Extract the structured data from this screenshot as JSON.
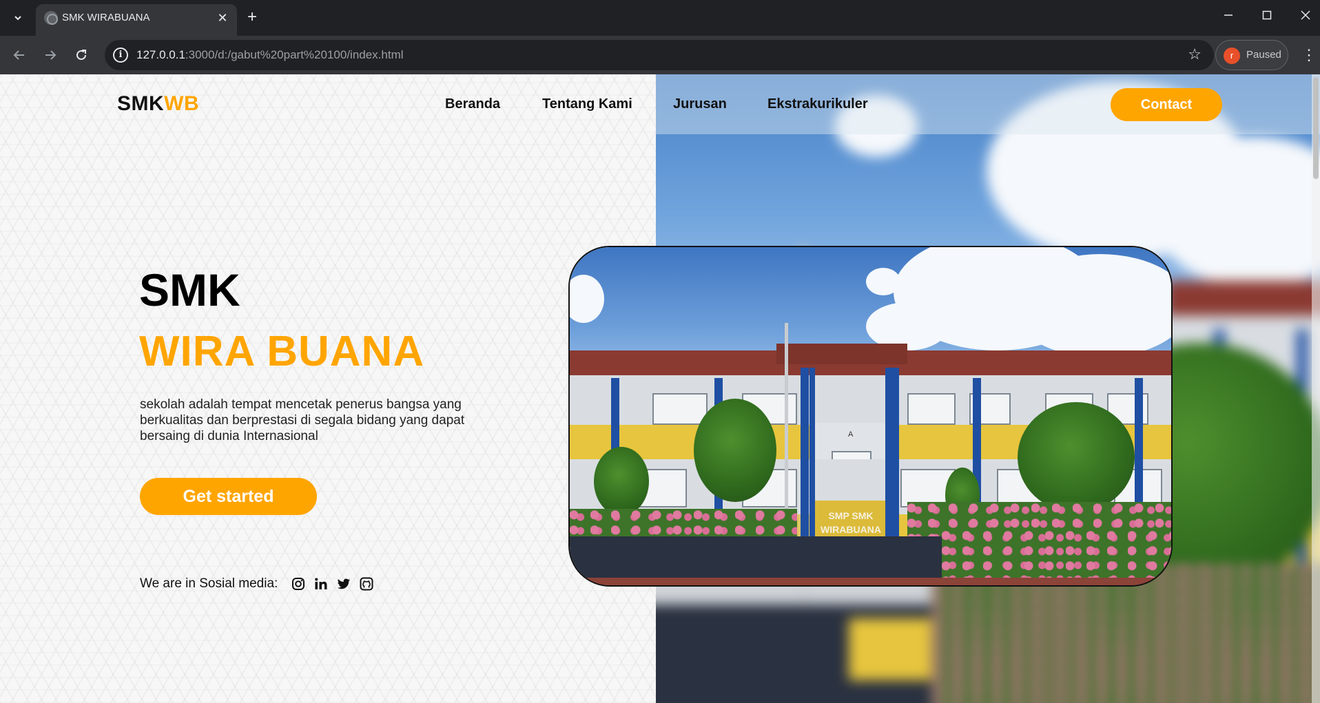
{
  "browser": {
    "tab_title": "SMK WIRABUANA",
    "url_host": "127.0.0.1",
    "url_rest": ":3000/d:/gabut%20part%20100/index.html",
    "profile_initial": "r",
    "profile_status": "Paused",
    "site_info_glyph": "i"
  },
  "navbar": {
    "logo_main": "SMK",
    "logo_accent": "WB",
    "links": [
      "Beranda",
      "Tentang Kami",
      "Jurusan",
      "Ekstrakurikuler"
    ],
    "contact_label": "Contact"
  },
  "hero": {
    "title_line1": "SMK",
    "title_line2": "WIRA BUANA",
    "description": "sekolah adalah tempat mencetak penerus bangsa yang berkualitas dan berprestasi di segala bidang yang dapat bersaing di dunia Internasional",
    "cta_label": "Get started",
    "social_label": "We are in Sosial media:",
    "social_icons": [
      "instagram-icon",
      "linkedin-icon",
      "twitter-icon",
      "github-icon"
    ]
  },
  "photo": {
    "signage": "SMP SMK WIRABUANA",
    "building_letter": "A"
  },
  "colors": {
    "accent": "#ffa500",
    "text_dark": "#111111"
  }
}
